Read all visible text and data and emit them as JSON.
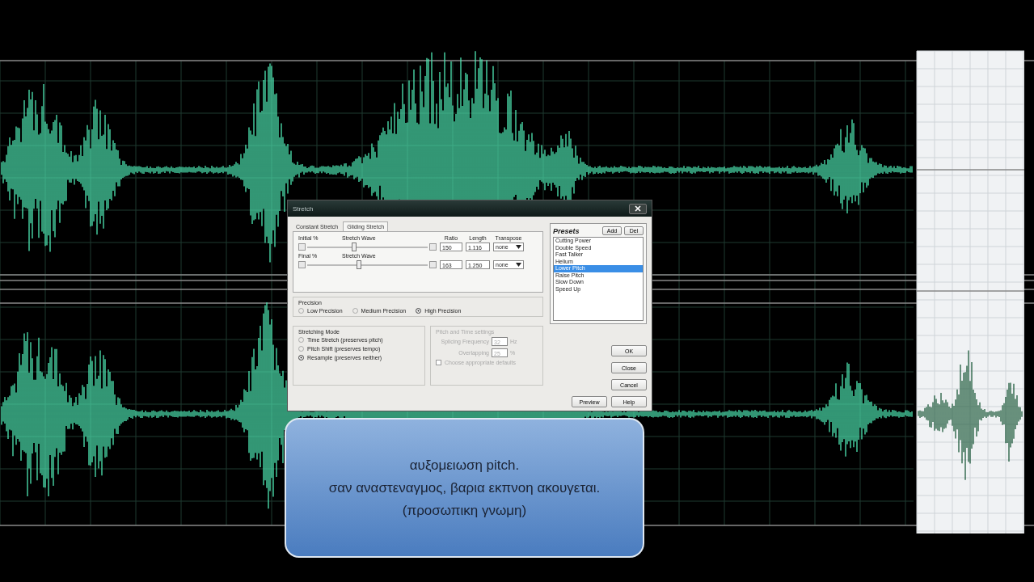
{
  "dialog": {
    "title": "Stretch",
    "tabs": [
      {
        "label": "Constant Stretch",
        "selected": false
      },
      {
        "label": "Gliding Stretch",
        "selected": true
      }
    ],
    "stretch_rows": [
      {
        "label": "Initial %",
        "wave_label": "Stretch Wave",
        "level": 0.37,
        "ratio": "150",
        "length": "1.116",
        "transpose": "none"
      },
      {
        "label": "Final %",
        "wave_label": "Stretch Wave",
        "level": 0.41,
        "ratio": "163",
        "length": "1.250",
        "transpose": "none"
      }
    ],
    "columns": [
      "Ratio",
      "Length",
      "Transpose"
    ],
    "precision": {
      "title": "Precision",
      "options": [
        {
          "label": "Low Precision",
          "selected": false
        },
        {
          "label": "Medium Precision",
          "selected": false
        },
        {
          "label": "High Precision",
          "selected": true
        }
      ]
    },
    "stretching_mode": {
      "title": "Stretching Mode",
      "options": [
        {
          "label": "Time Stretch (preserves pitch)",
          "selected": false
        },
        {
          "label": "Pitch Shift (preserves tempo)",
          "selected": false
        },
        {
          "label": "Resample (preserves neither)",
          "selected": true
        }
      ]
    },
    "pitch_time": {
      "title": "Pitch and Time settings",
      "disabled": true,
      "fields": [
        {
          "label": "Splicing Frequency",
          "value": "32",
          "unit": "Hz"
        },
        {
          "label": "Overlapping",
          "value": "25",
          "unit": "%"
        }
      ],
      "checkbox": {
        "label": "Choose appropriate defaults",
        "checked": false
      }
    },
    "presets": {
      "title": "Presets",
      "buttons": [
        "Add",
        "Del"
      ],
      "items": [
        {
          "label": "Cutting Power",
          "selected": false
        },
        {
          "label": "Double Speed",
          "selected": false
        },
        {
          "label": "Fast Talker",
          "selected": false
        },
        {
          "label": "Helium",
          "selected": false
        },
        {
          "label": "Lower Pitch",
          "selected": true
        },
        {
          "label": "Raise Pitch",
          "selected": false
        },
        {
          "label": "Slow Down",
          "selected": false
        },
        {
          "label": "Speed Up",
          "selected": false
        }
      ]
    },
    "buttons": [
      "OK",
      "Close",
      "Cancel"
    ],
    "bottom_buttons": [
      "Preview",
      "Help"
    ]
  },
  "caption": [
    "αυξομειωση pitch.",
    "σαν αναστεναγμος, βαρια εκπνοη ακουγεται.",
    "(προσωπικη γνωμη)"
  ]
}
